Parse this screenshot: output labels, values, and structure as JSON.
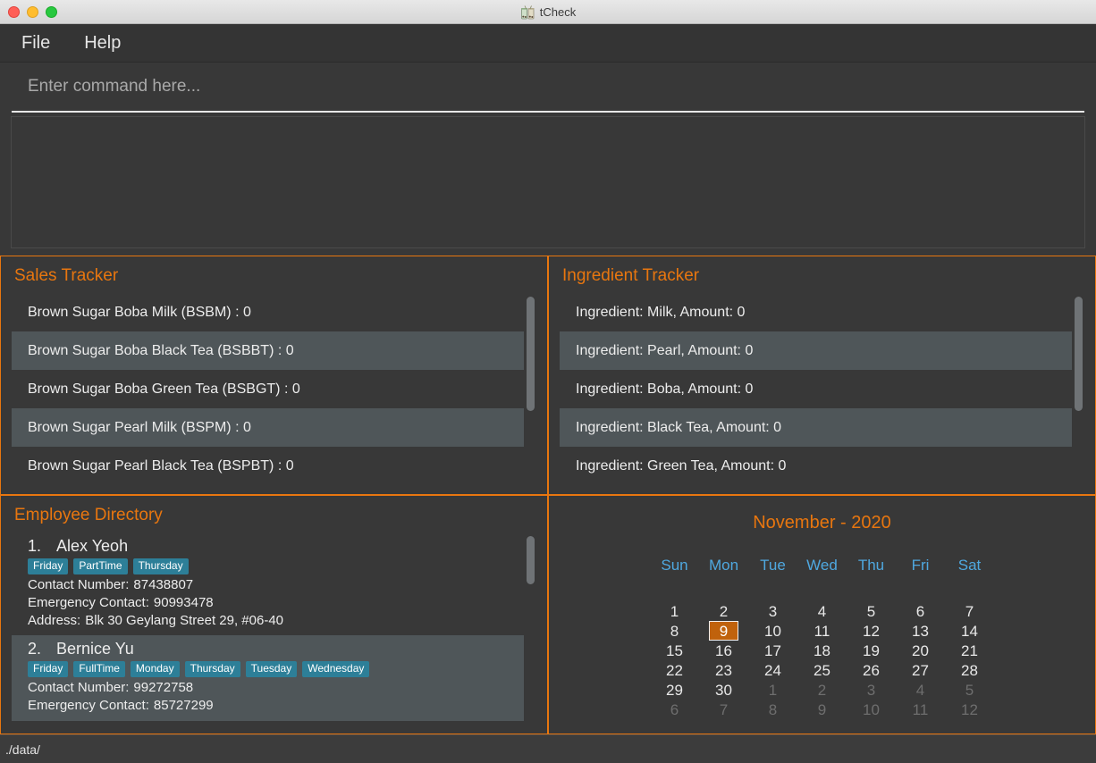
{
  "window": {
    "title": "tCheck",
    "app_icon": "bubble-tea-icon",
    "traffic_lights": [
      "close",
      "minimize",
      "maximize"
    ]
  },
  "menu": {
    "items": [
      {
        "label": "File"
      },
      {
        "label": "Help"
      }
    ]
  },
  "command": {
    "placeholder": "Enter command here...",
    "value": ""
  },
  "result": {
    "text": ""
  },
  "sales_tracker": {
    "title": "Sales Tracker",
    "items": [
      "Brown Sugar Boba Milk (BSBM) : 0",
      "Brown Sugar Boba Black Tea (BSBBT) : 0",
      "Brown Sugar Boba Green Tea (BSBGT) : 0",
      "Brown Sugar Pearl Milk (BSPM) : 0",
      "Brown Sugar Pearl Black Tea (BSPBT) : 0"
    ]
  },
  "ingredient_tracker": {
    "title": "Ingredient Tracker",
    "items": [
      "Ingredient: Milk,  Amount: 0",
      "Ingredient: Pearl,  Amount: 0",
      "Ingredient: Boba,  Amount: 0",
      "Ingredient: Black Tea,  Amount: 0",
      "Ingredient: Green Tea,  Amount: 0"
    ]
  },
  "employee_directory": {
    "title": "Employee Directory",
    "labels": {
      "contact": "Contact Number:",
      "emergency": "Emergency Contact:",
      "address": "Address:"
    },
    "employees": [
      {
        "index": "1.",
        "name": "Alex Yeoh",
        "tags": [
          "Friday",
          "PartTime",
          "Thursday"
        ],
        "contact": "87438807",
        "emergency": "90993478",
        "address": "Blk 30 Geylang Street 29, #06-40"
      },
      {
        "index": "2.",
        "name": "Bernice Yu",
        "tags": [
          "Friday",
          "FullTime",
          "Monday",
          "Thursday",
          "Tuesday",
          "Wednesday"
        ],
        "contact": "99272758",
        "emergency": "85727299",
        "address": ""
      }
    ]
  },
  "calendar": {
    "title": "November - 2020",
    "month": "November",
    "year": "2020",
    "day_names": [
      "Sun",
      "Mon",
      "Tue",
      "Wed",
      "Thu",
      "Fri",
      "Sat"
    ],
    "selected_day": 9,
    "weeks": [
      [
        {
          "n": "1",
          "cur": true
        },
        {
          "n": "2",
          "cur": true
        },
        {
          "n": "3",
          "cur": true
        },
        {
          "n": "4",
          "cur": true
        },
        {
          "n": "5",
          "cur": true
        },
        {
          "n": "6",
          "cur": true
        },
        {
          "n": "7",
          "cur": true
        }
      ],
      [
        {
          "n": "8",
          "cur": true
        },
        {
          "n": "9",
          "cur": true,
          "today": true
        },
        {
          "n": "10",
          "cur": true
        },
        {
          "n": "11",
          "cur": true
        },
        {
          "n": "12",
          "cur": true
        },
        {
          "n": "13",
          "cur": true
        },
        {
          "n": "14",
          "cur": true
        }
      ],
      [
        {
          "n": "15",
          "cur": true
        },
        {
          "n": "16",
          "cur": true
        },
        {
          "n": "17",
          "cur": true
        },
        {
          "n": "18",
          "cur": true
        },
        {
          "n": "19",
          "cur": true
        },
        {
          "n": "20",
          "cur": true
        },
        {
          "n": "21",
          "cur": true
        }
      ],
      [
        {
          "n": "22",
          "cur": true
        },
        {
          "n": "23",
          "cur": true
        },
        {
          "n": "24",
          "cur": true
        },
        {
          "n": "25",
          "cur": true
        },
        {
          "n": "26",
          "cur": true
        },
        {
          "n": "27",
          "cur": true
        },
        {
          "n": "28",
          "cur": true
        }
      ],
      [
        {
          "n": "29",
          "cur": true
        },
        {
          "n": "30",
          "cur": true
        },
        {
          "n": "1",
          "cur": false
        },
        {
          "n": "2",
          "cur": false
        },
        {
          "n": "3",
          "cur": false
        },
        {
          "n": "4",
          "cur": false
        },
        {
          "n": "5",
          "cur": false
        }
      ],
      [
        {
          "n": "6",
          "cur": false
        },
        {
          "n": "7",
          "cur": false
        },
        {
          "n": "8",
          "cur": false
        },
        {
          "n": "9",
          "cur": false
        },
        {
          "n": "10",
          "cur": false
        },
        {
          "n": "11",
          "cur": false
        },
        {
          "n": "12",
          "cur": false
        }
      ]
    ]
  },
  "status_bar": {
    "path": "./data/"
  },
  "colors": {
    "accent_orange": "#e8760f",
    "panel_bg": "#383838",
    "row_alt_bg": "#4f5659",
    "tag_bg": "#2d7f98",
    "dow_blue": "#4fa8e0",
    "today_bg": "#c0620c",
    "window_bg": "#2e2e2e"
  }
}
